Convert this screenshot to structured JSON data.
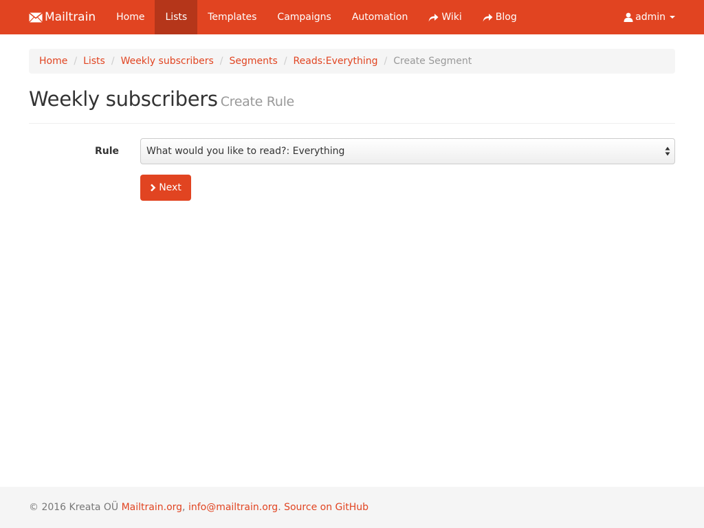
{
  "navbar": {
    "brand": "Mailtrain",
    "items": [
      {
        "label": "Home"
      },
      {
        "label": "Lists"
      },
      {
        "label": "Templates"
      },
      {
        "label": "Campaigns"
      },
      {
        "label": "Automation"
      },
      {
        "label": "Wiki"
      },
      {
        "label": "Blog"
      }
    ],
    "active_item": "Lists",
    "user": "admin"
  },
  "breadcrumb": {
    "links": [
      "Home",
      "Lists",
      "Weekly subscribers",
      "Segments",
      "Reads:Everything"
    ],
    "current": "Create Segment"
  },
  "header": {
    "title": "Weekly subscribers",
    "subtitle": "Create Rule"
  },
  "form": {
    "rule_label": "Rule",
    "rule_value": "What would you like to read?: Everything",
    "next_label": "Next"
  },
  "footer": {
    "copyright": "© 2016 Kreata OÜ",
    "site_link": "Mailtrain.org",
    "email_link": "info@mailtrain.org",
    "github_link": "Source on GitHub"
  },
  "colors": {
    "brand": "#e14421",
    "nav_active": "#b5361a",
    "breadcrumb_bg": "#f5f5f5",
    "footer_bg": "#f5f5f5"
  },
  "icons": {
    "brand": "envelope-icon",
    "wiki": "share-arrow-icon",
    "blog": "share-arrow-icon",
    "user": "user-icon",
    "next": "chevron-right-icon"
  }
}
